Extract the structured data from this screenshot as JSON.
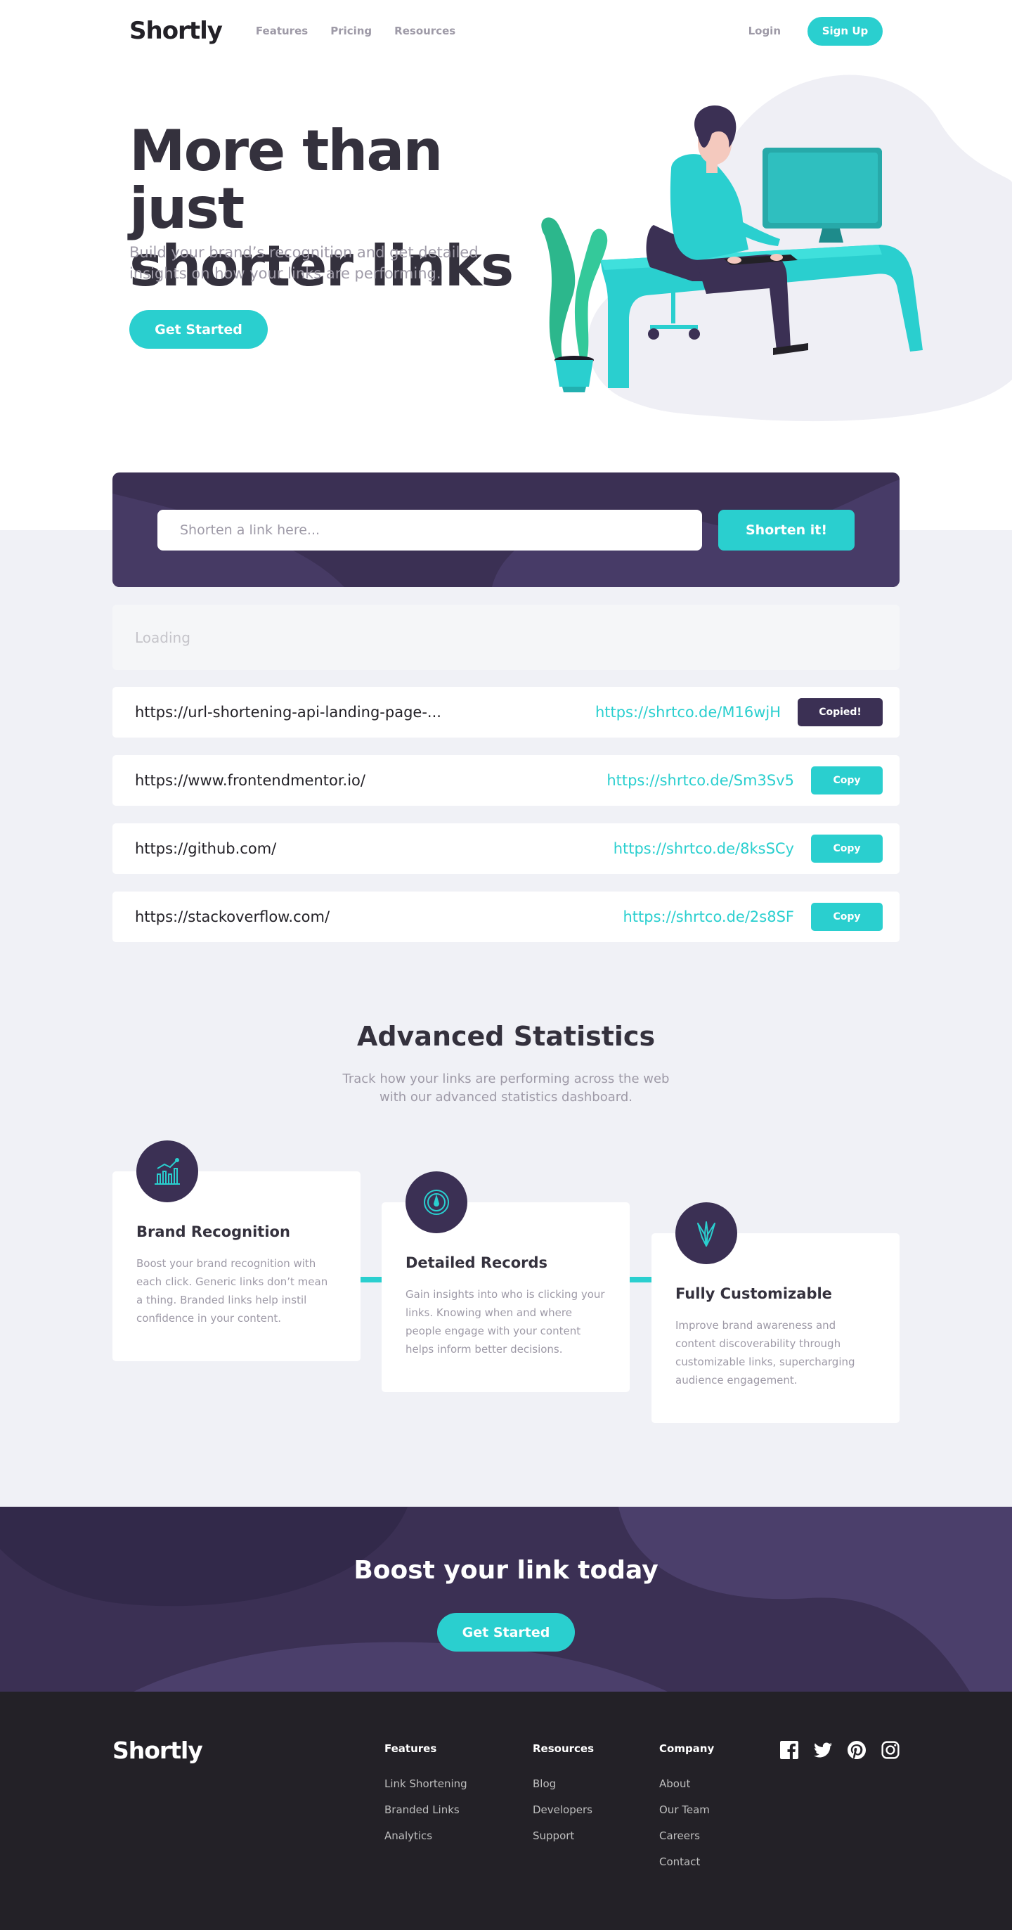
{
  "brand": {
    "name": "Shortly",
    "primary": "#2acfcf",
    "dark_violet": "#3b3054",
    "very_dark": "#232127",
    "gray": "#9e9aa7"
  },
  "header": {
    "logo": "Shortly",
    "nav": [
      "Features",
      "Pricing",
      "Resources"
    ],
    "login": "Login",
    "signup": "Sign Up"
  },
  "hero": {
    "title_line1": "More than just",
    "title_line2": "shorter links",
    "subtitle": "Build your brand’s recognition and get detailed insights on how your links are performing.",
    "cta": "Get Started"
  },
  "shorten": {
    "placeholder": "Shorten a link here...",
    "button": "Shorten it!",
    "loading": "Loading"
  },
  "links": [
    {
      "original": "https://url-shortening-api-landing-page-...",
      "short": "https://shrtco.de/M16wjH",
      "action": "Copied!",
      "state": "copied"
    },
    {
      "original": "https://www.frontendmentor.io/",
      "short": "https://shrtco.de/Sm3Sv5",
      "action": "Copy",
      "state": "copy"
    },
    {
      "original": "https://github.com/",
      "short": "https://shrtco.de/8ksSCy",
      "action": "Copy",
      "state": "copy"
    },
    {
      "original": "https://stackoverflow.com/",
      "short": "https://shrtco.de/2s8SF",
      "action": "Copy",
      "state": "copy"
    }
  ],
  "stats": {
    "title": "Advanced Statistics",
    "subtitle": "Track how your links are performing across the web with our advanced statistics dashboard.",
    "cards": [
      {
        "icon": "chart-icon",
        "title": "Brand Recognition",
        "text": "Boost your brand recognition with each click. Generic links don’t mean a thing. Branded links help instil confidence in your content."
      },
      {
        "icon": "gauge-icon",
        "title": "Detailed Records",
        "text": "Gain insights into who is clicking your links. Knowing when and where people engage with your content helps inform better decisions."
      },
      {
        "icon": "brushes-icon",
        "title": "Fully Customizable",
        "text": "Improve brand awareness and content discoverability through customizable links, supercharging audience engagement."
      }
    ]
  },
  "boost": {
    "title": "Boost your link today",
    "cta": "Get Started"
  },
  "footer": {
    "logo": "Shortly",
    "columns": [
      {
        "title": "Features",
        "links": [
          "Link Shortening",
          "Branded Links",
          "Analytics"
        ]
      },
      {
        "title": "Resources",
        "links": [
          "Blog",
          "Developers",
          "Support"
        ]
      },
      {
        "title": "Company",
        "links": [
          "About",
          "Our Team",
          "Careers",
          "Contact"
        ]
      }
    ],
    "social": [
      "facebook-icon",
      "twitter-icon",
      "pinterest-icon",
      "instagram-icon"
    ]
  }
}
